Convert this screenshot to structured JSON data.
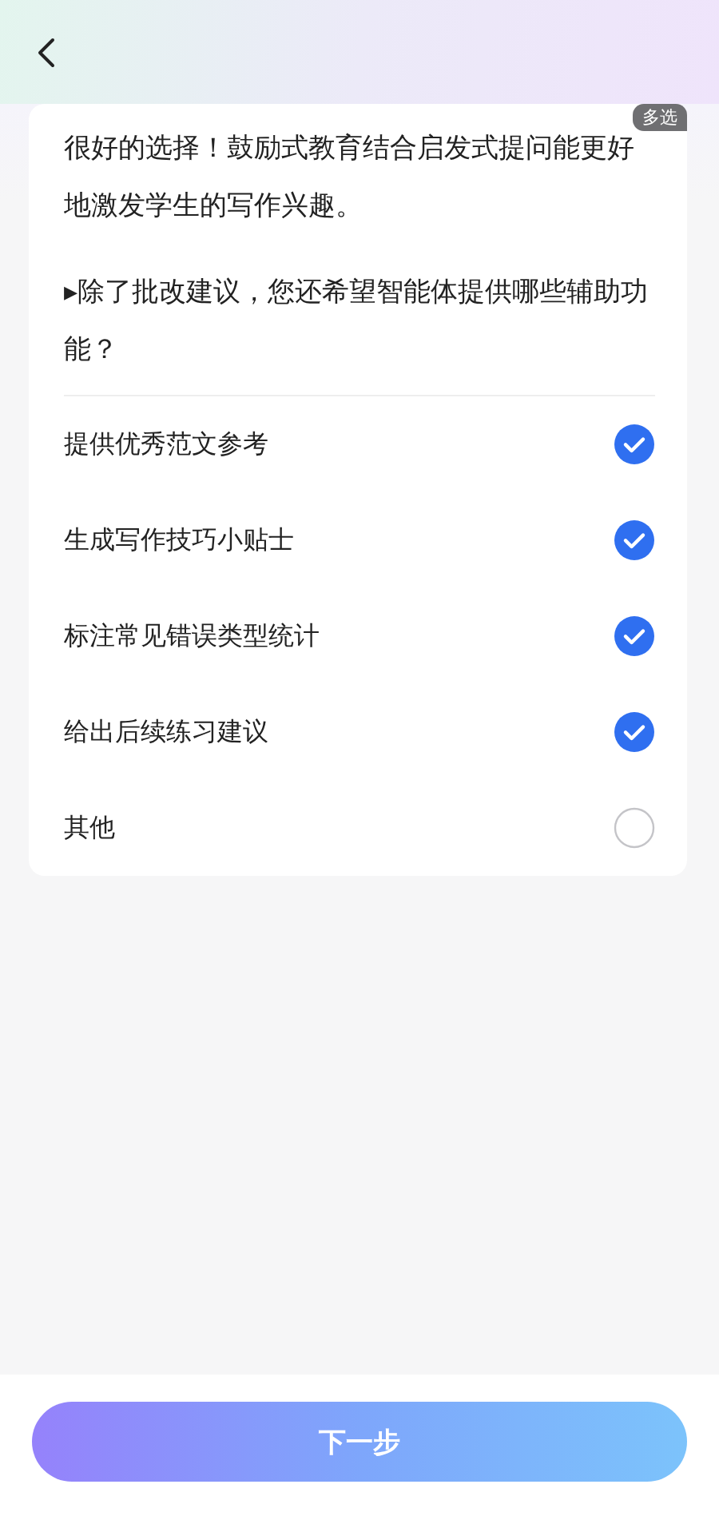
{
  "card": {
    "badge": "多选",
    "message": "很好的选择！鼓励式教育结合启发式提问能更好地激发学生的写作兴趣。",
    "question": "▸除了批改建议，您还希望智能体提供哪些辅助功能？",
    "options": [
      {
        "label": "提供优秀范文参考",
        "checked": true
      },
      {
        "label": "生成写作技巧小贴士",
        "checked": true
      },
      {
        "label": "标注常见错误类型统计",
        "checked": true
      },
      {
        "label": "给出后续练习建议",
        "checked": true
      },
      {
        "label": "其他",
        "checked": false
      }
    ]
  },
  "footer": {
    "button": "下一步"
  }
}
